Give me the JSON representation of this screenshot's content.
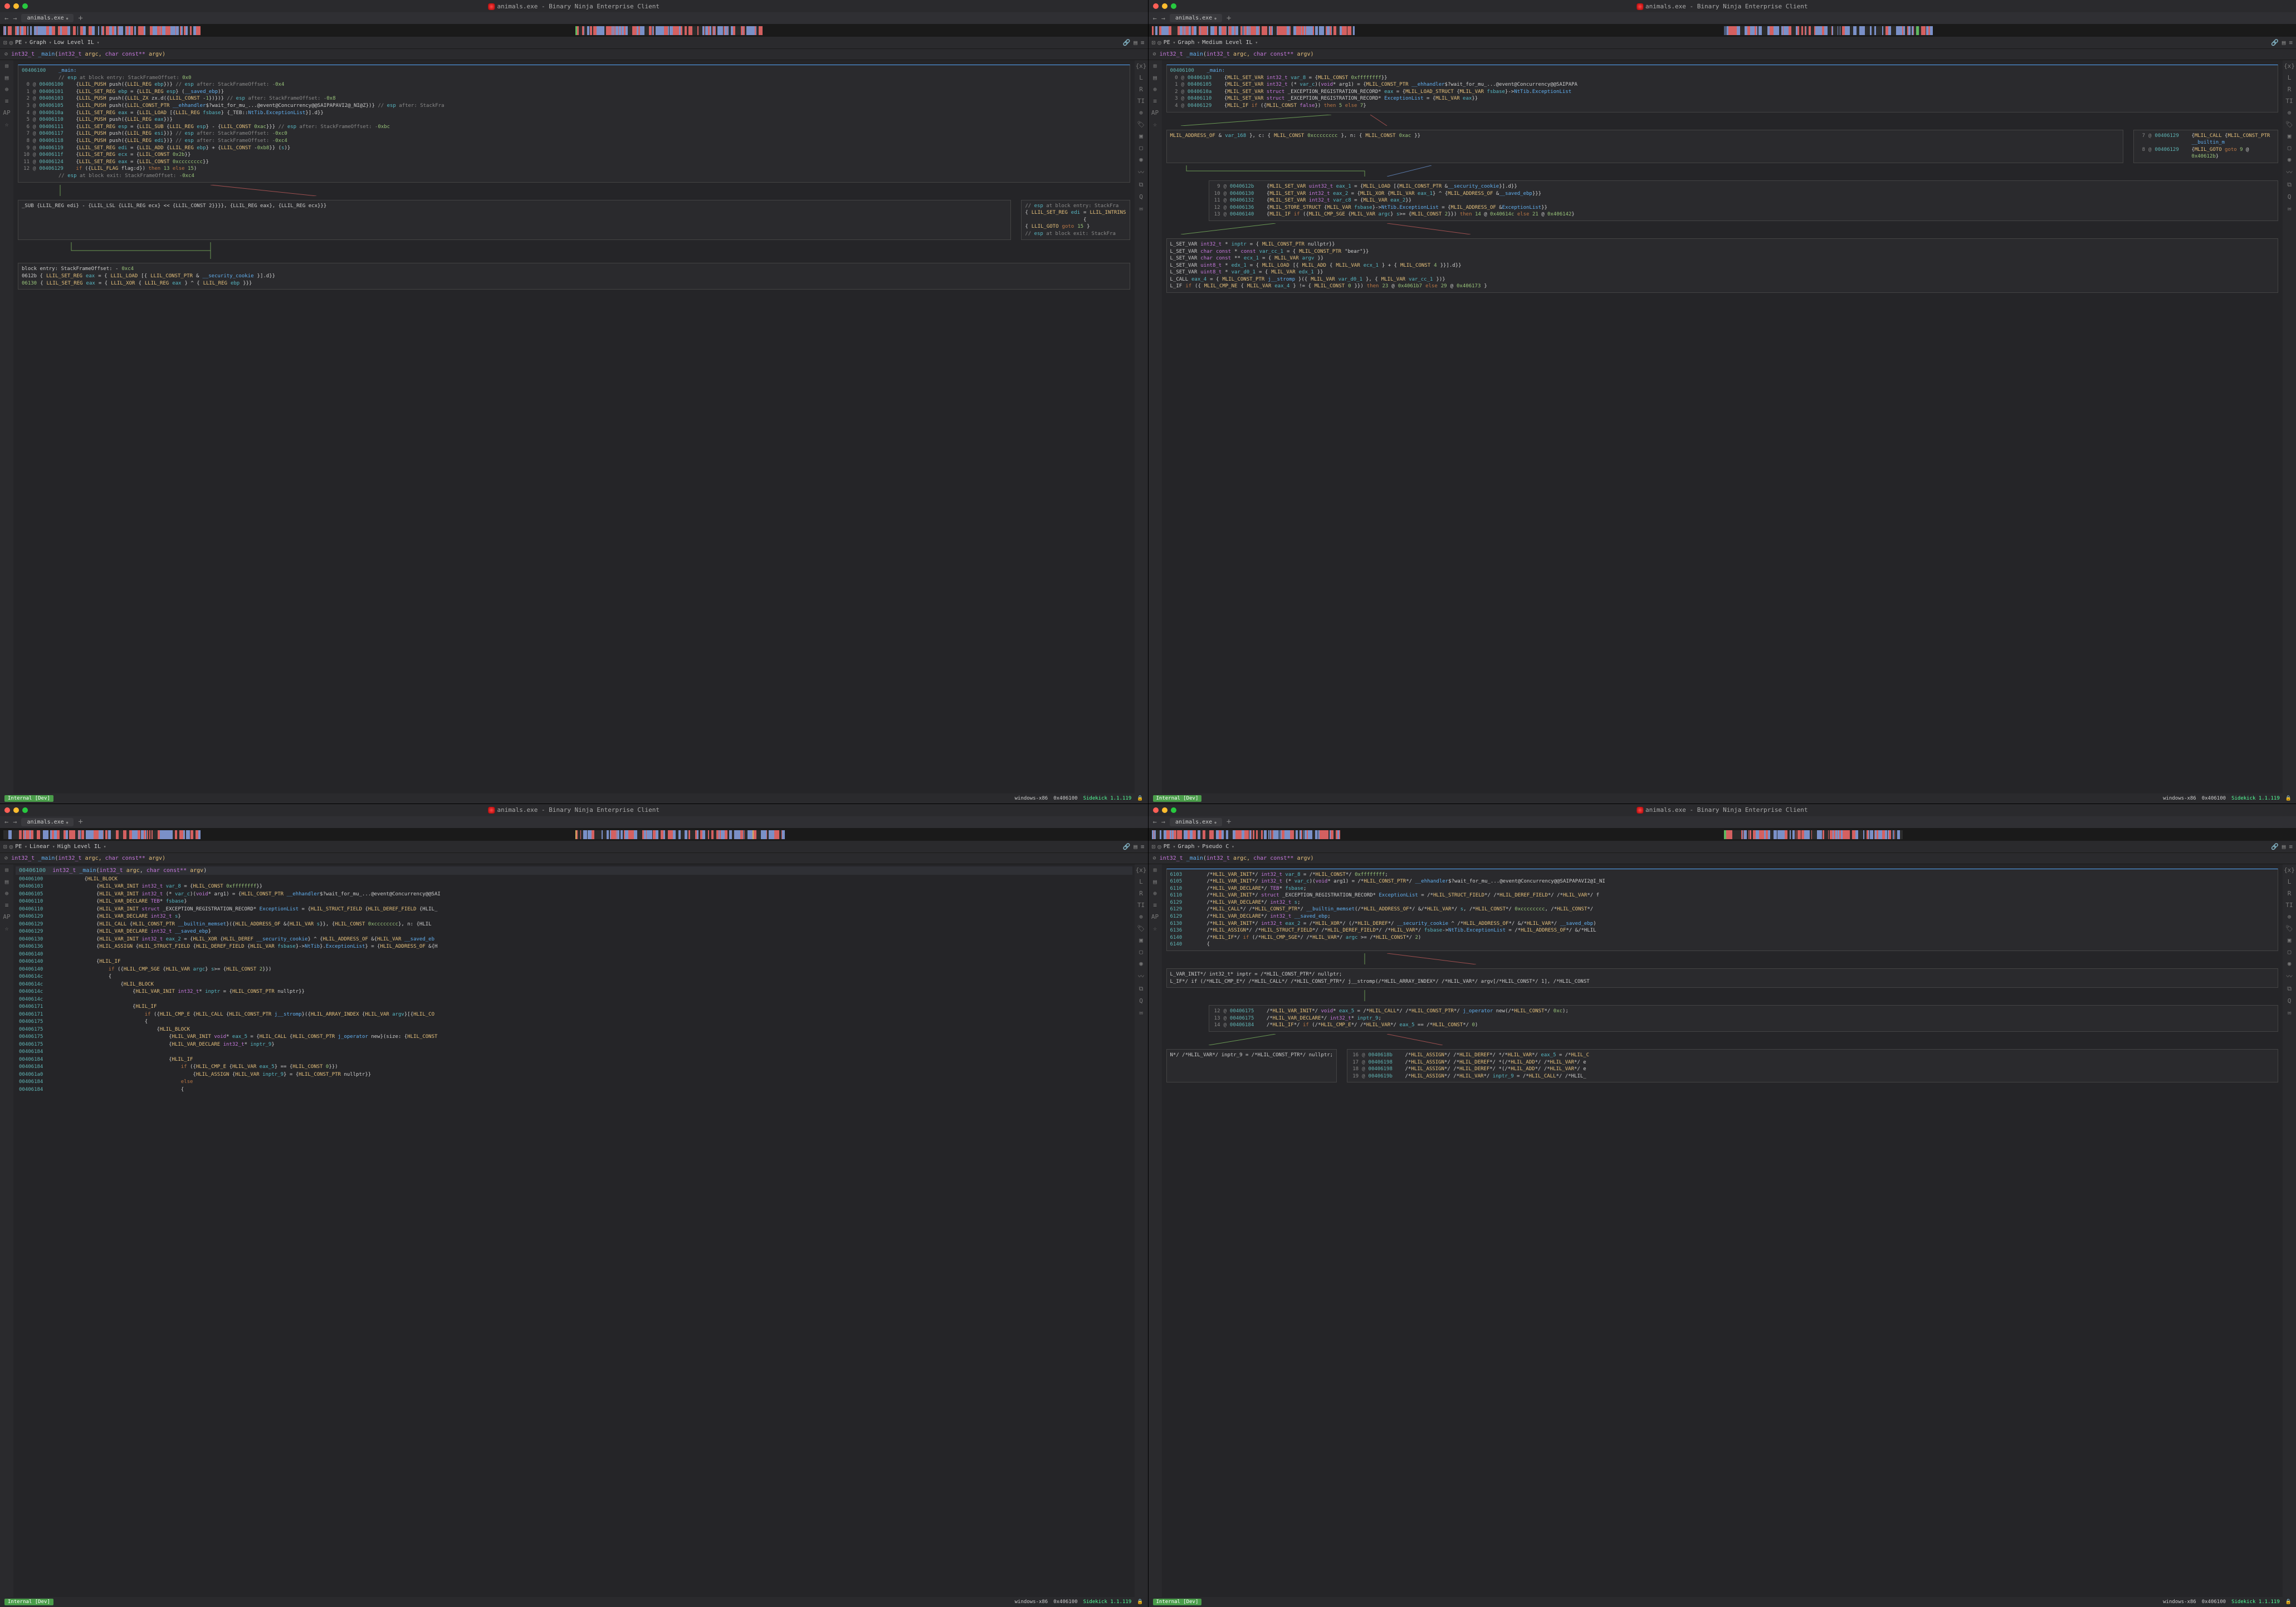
{
  "title_text": "animals.exe - Binary Ninja Enterprise Client",
  "tab_label": "animals.exe",
  "feature": {
    "pe": "PE",
    "graph": "Graph",
    "linear": "Linear",
    "il_low": "Low Level IL",
    "il_med": "Medium Level IL",
    "il_high": "High Level IL",
    "il_pseudo": "Pseudo C"
  },
  "fn_sig": {
    "pre": "int32_t ",
    "name": "_main",
    "args_open": "(",
    "arg1_type": "int32_t ",
    "arg1_name": "argc, ",
    "arg2_type": "char const** ",
    "arg2_name": "argv)",
    "icon": "⊘"
  },
  "fn_hl_sig": "int32_t _main(int32_t argc, char const** argv)",
  "status": {
    "internal": "Internal [Dev]",
    "arch": "windows-x86",
    "addr": "0x406100",
    "sidekick": "Sidekick 1.1.119"
  },
  "pane1": {
    "header_addr": "00406100",
    "header_label": "_main:",
    "lines": [
      {
        "addr": "",
        "text": "// esp at block entry: StackFrameOffset: 0x0",
        "cls": "kw-comment"
      },
      {
        "i": "0",
        "addr": "00406100",
        "text": "{LLIL_PUSH push({LLIL_REG ebp})}  // esp after: StackFrameOffset: -0x4"
      },
      {
        "i": "1",
        "addr": "00406101",
        "text": "{LLIL_SET_REG ebp = {LLIL_REG esp} (__saved_ebp)}"
      },
      {
        "i": "2",
        "addr": "00406103",
        "text": "{LLIL_PUSH push({LLIL_ZX zx.d({LLIL_CONST -1})})}  // esp after: StackFrameOffset: -0x8"
      },
      {
        "i": "3",
        "addr": "00406105",
        "text": "{LLIL_PUSH push({LLIL_CONST_PTR __ehhandler$?wait_for_mu_...@event@Concurrency@@SAIPAPAVI2@_NI@Z})}  // esp after: StackFra"
      },
      {
        "i": "4",
        "addr": "0040610a",
        "text": "{LLIL_SET_REG eax = {LLIL_LOAD [{LLIL_REG fsbase} {_TEB::NtTib.ExceptionList}].d}}"
      },
      {
        "i": "5",
        "addr": "00406110",
        "text": "{LLIL_PUSH push({LLIL_REG eax})}"
      },
      {
        "i": "6",
        "addr": "00406111",
        "text": "{LLIL_SET_REG esp = {LLIL_SUB {LLIL_REG esp} - {LLIL_CONST 0xac}}}  // esp after: StackFrameOffset: -0xbc"
      },
      {
        "i": "7",
        "addr": "00406117",
        "text": "{LLIL_PUSH push({LLIL_REG esi})}  // esp after: StackFrameOffset: -0xc0"
      },
      {
        "i": "8",
        "addr": "00406118",
        "text": "{LLIL_PUSH push({LLIL_REG edi})}  // esp after: StackFrameOffset: -0xc4"
      },
      {
        "i": "9",
        "addr": "00406119",
        "text": "{LLIL_SET_REG edi = {LLIL_ADD {LLIL_REG ebp} + {LLIL_CONST -0xb8}} (s)}"
      },
      {
        "i": "10",
        "addr": "0040611f",
        "text": "{LLIL_SET_REG ecx = {LLIL_CONST 0x2b}}"
      },
      {
        "i": "11",
        "addr": "00406124",
        "text": "{LLIL_SET_REG eax = {LLIL_CONST 0xcccccccc}}"
      },
      {
        "i": "12",
        "addr": "00406129",
        "text": "if ({LLIL_FLAG flag:d}) then 13 else 15)"
      },
      {
        "addr": "",
        "text": "// esp at block exit: StackFrameOffset: -0xc4",
        "cls": "kw-comment"
      }
    ],
    "subblock": "_SUB {LLIL_REG edi} - {LLIL_LSL {LLIL_REG ecx} << {LLIL_CONST 2}}}}, {LLIL_REG eax}, {LLIL_REG ecx}}}",
    "sideblock": [
      "// esp at block entry: StackFra",
      "{LLIL_SET_REG edi = {LLIL_INTRINS",
      "{LLIL_GOTO goto 15}",
      "// esp at block exit: StackFra"
    ],
    "bottom": [
      "block entry: StackFrameOffset: -0xc4",
      "0612b  {LLIL_SET_REG eax = {LLIL_LOAD [{LLIL_CONST_PTR &__security_cookie}].d}}",
      "06130  {LLIL_SET_REG eax = {LLIL_XOR {LLIL_REG eax} ^ {LLIL_REG ebp}}}"
    ]
  },
  "pane2": {
    "header_addr": "00406100",
    "header_label": "_main:",
    "lines": [
      {
        "i": "0",
        "addr": "00406103",
        "text": "{MLIL_SET_VAR int32_t var_8 = {MLIL_CONST 0xffffffff}}"
      },
      {
        "i": "1",
        "addr": "00406105",
        "text": "{MLIL_SET_VAR int32_t (* var_c)(void* arg1) = {MLIL_CONST_PTR __ehhandler$?wait_for_mu_...@event@Concurrency@@SAIPAPA"
      },
      {
        "i": "2",
        "addr": "0040610a",
        "text": "{MLIL_SET_VAR struct _EXCEPTION_REGISTRATION_RECORD* eax = {MLIL_LOAD_STRUCT {MLIL_VAR fsbase}->NtTib.ExceptionList"
      },
      {
        "i": "3",
        "addr": "00406110",
        "text": "{MLIL_SET_VAR struct _EXCEPTION_REGISTRATION_RECORD* ExceptionList = {MLIL_VAR eax}}"
      },
      {
        "i": "4",
        "addr": "00406129",
        "text": "{MLIL_IF if ({MLIL_CONST false}) then 5 else 7}"
      }
    ],
    "line57": [
      {
        "text": "MLIL_ADDRESS_OF &var_168}, c: {MLIL_CONST 0xcccccccc}, n: {MLIL_CONST 0xac}}"
      }
    ],
    "block57b": [
      {
        "i": "7",
        "addr": "00406129",
        "text": "{MLIL_CALL {MLIL_CONST_PTR __builtin_m"
      },
      {
        "i": "8",
        "addr": "00406129",
        "text": "{MLIL_GOTO goto 9 @ 0x40612b}"
      }
    ],
    "block9": [
      {
        "i": "9",
        "addr": "0040612b",
        "text": "{MLIL_SET_VAR uint32_t eax_1 = {MLIL_LOAD [{MLIL_CONST_PTR &__security_cookie}].d}}"
      },
      {
        "i": "10",
        "addr": "00406130",
        "text": "{MLIL_SET_VAR int32_t eax_2 = {MLIL_XOR {MLIL_VAR eax_1} ^ {MLIL_ADDRESS_OF &__saved_ebp}}}"
      },
      {
        "i": "11",
        "addr": "00406132",
        "text": "{MLIL_SET_VAR int32_t var_c8 = {MLIL_VAR eax_2}}"
      },
      {
        "i": "12",
        "addr": "00406136",
        "text": "{MLIL_STORE_STRUCT {MLIL_VAR fsbase}->NtTib.ExceptionList = {MLIL_ADDRESS_OF &ExceptionList}}"
      },
      {
        "i": "13",
        "addr": "00406140",
        "text": "{MLIL_IF if ({MLIL_CMP_SGE {MLIL_VAR argc} s>= {MLIL_CONST 2}}) then 14 @ 0x40614c else 21 @ 0x406142}"
      }
    ],
    "bottom": [
      "L_SET_VAR int32_t* inptr = {MLIL_CONST_PTR nullptr}}",
      "L_SET_VAR char const* const var_cc_1 = {MLIL_CONST_PTR \"bear\"}}",
      "L_SET_VAR char const** ecx_1 = {MLIL_VAR argv}}",
      "L_SET_VAR uint8_t* edx_1 = {MLIL_LOAD [{MLIL_ADD {MLIL_VAR ecx_1} + {MLIL_CONST 4}}].d}}",
      "L_SET_VAR uint8_t* var_d0_1 = {MLIL_VAR edx_1}}",
      "L_CALL eax_4 = {MLIL_CONST_PTR j__stromp}({MLIL_VAR var_d0_1}, {MLIL_VAR var_cc_1})}",
      "L_IF if ({MLIL_CMP_NE {MLIL_VAR eax_4} != {MLIL_CONST 0}}) then 23 @ 0x4061b7 else 29 @ 0x406173}"
    ]
  },
  "pane3": {
    "header_addr": "00406100",
    "hl_sig_addr": "00406100",
    "lines": [
      {
        "addr": "00406100",
        "ind": 2,
        "text": "{HLIL_BLOCK"
      },
      {
        "addr": "00406103",
        "ind": 3,
        "text": "{HLIL_VAR_INIT int32_t var_8 = {HLIL_CONST 0xffffffff}}"
      },
      {
        "addr": "00406105",
        "ind": 3,
        "text": "{HLIL_VAR_INIT int32_t (* var_c)(void* arg1) = {HLIL_CONST_PTR __ehhandler$?wait_for_mu_...@event@Concurrency@@SAI"
      },
      {
        "addr": "00406110",
        "ind": 3,
        "text": "{HLIL_VAR_DECLARE TEB* fsbase}"
      },
      {
        "addr": "00406110",
        "ind": 3,
        "text": "{HLIL_VAR_INIT struct _EXCEPTION_REGISTRATION_RECORD* ExceptionList = {HLIL_STRUCT_FIELD {HLIL_DEREF_FIELD {HLIL_"
      },
      {
        "addr": "00406129",
        "ind": 3,
        "text": "{HLIL_VAR_DECLARE int32_t s}"
      },
      {
        "addr": "00406129",
        "ind": 3,
        "text": "{HLIL_CALL {HLIL_CONST_PTR __builtin_memset}({HLIL_ADDRESS_OF &{HLIL_VAR s}}, {HLIL_CONST 0xcccccccc}, n: {HLIL"
      },
      {
        "addr": "00406129",
        "ind": 3,
        "text": "{HLIL_VAR_DECLARE int32_t __saved_ebp}"
      },
      {
        "addr": "00406130",
        "ind": 3,
        "text": "{HLIL_VAR_INIT int32_t eax_2 = {HLIL_XOR {HLIL_DEREF __security_cookie} ^ {HLIL_ADDRESS_OF &{HLIL_VAR __saved_eb"
      },
      {
        "addr": "00406136",
        "ind": 3,
        "text": "{HLIL_ASSIGN {HLIL_STRUCT_FIELD {HLIL_DEREF_FIELD {HLIL_VAR fsbase}->NtTib}.ExceptionList} = {HLIL_ADDRESS_OF &{H"
      },
      {
        "addr": "00406140",
        "ind": 3,
        "text": ""
      },
      {
        "addr": "00406140",
        "ind": 3,
        "text": "{HLIL_IF"
      },
      {
        "addr": "00406140",
        "ind": 4,
        "text": "if ({HLIL_CMP_SGE {HLIL_VAR argc} s>= {HLIL_CONST 2}})"
      },
      {
        "addr": "0040614c",
        "ind": 4,
        "text": "{"
      },
      {
        "addr": "0040614c",
        "ind": 5,
        "text": "{HLIL_BLOCK"
      },
      {
        "addr": "0040614c",
        "ind": 6,
        "text": "{HLIL_VAR_INIT int32_t* inptr = {HLIL_CONST_PTR nullptr}}"
      },
      {
        "addr": "0040614c",
        "ind": 6,
        "text": ""
      },
      {
        "addr": "00406171",
        "ind": 6,
        "text": "{HLIL_IF"
      },
      {
        "addr": "00406171",
        "ind": 7,
        "text": "if ({HLIL_CMP_E {HLIL_CALL {HLIL_CONST_PTR j__stromp}({HLIL_ARRAY_INDEX {HLIL_VAR argv}[{HLIL_CO"
      },
      {
        "addr": "00406175",
        "ind": 7,
        "text": "{"
      },
      {
        "addr": "00406175",
        "ind": 8,
        "text": "{HLIL_BLOCK"
      },
      {
        "addr": "00406175",
        "ind": 9,
        "text": "{HLIL_VAR_INIT void* eax_5 = {HLIL_CALL {HLIL_CONST_PTR j_operator new}(size: {HLIL_CONST"
      },
      {
        "addr": "00406175",
        "ind": 9,
        "text": "{HLIL_VAR_DECLARE int32_t* inptr_9}"
      },
      {
        "addr": "00406184",
        "ind": 9,
        "text": ""
      },
      {
        "addr": "00406184",
        "ind": 9,
        "text": "{HLIL_IF"
      },
      {
        "addr": "00406184",
        "ind": 10,
        "text": "if ({HLIL_CMP_E {HLIL_VAR eax_5} == {HLIL_CONST 0}})"
      },
      {
        "addr": "004061a0",
        "ind": 11,
        "text": "{HLIL_ASSIGN {HLIL_VAR inptr_9} = {HLIL_CONST_PTR nullptr}}"
      },
      {
        "addr": "00406184",
        "ind": 10,
        "text": "else"
      },
      {
        "addr": "00406184",
        "ind": 10,
        "text": "{"
      }
    ]
  },
  "pane4": {
    "lines": [
      {
        "addr": "6103",
        "text": "/*HLIL_VAR_INIT*/ int32_t var_8 = /*HLIL_CONST*/ 0xffffffff;"
      },
      {
        "addr": "6105",
        "text": "/*HLIL_VAR_INIT*/ int32_t (* var_c)(void* arg1) = /*HLIL_CONST_PTR*/ __ehhandler$?wait_for_mu_...@event@Concurrency@@SAIPAPAVI2@I_NI"
      },
      {
        "addr": "6110",
        "text": "/*HLIL_VAR_DECLARE*/ TEB* fsbase;"
      },
      {
        "addr": "6110",
        "text": "/*HLIL_VAR_INIT*/ struct _EXCEPTION_REGISTRATION_RECORD* ExceptionList = /*HLIL_STRUCT_FIELD*/ /*HLIL_DEREF_FIELD*/ /*HLIL_VAR*/ f"
      },
      {
        "addr": "6129",
        "text": "/*HLIL_VAR_DECLARE*/ int32_t s;"
      },
      {
        "addr": "6129",
        "text": "/*HLIL_CALL*/ /*HLIL_CONST_PTR*/ __builtin_memset(/*HLIL_ADDRESS_OF*/ &/*HLIL_VAR*/ s, /*HLIL_CONST*/ 0xcccccccc, /*HLIL_CONST*/"
      },
      {
        "addr": "6129",
        "text": "/*HLIL_VAR_DECLARE*/ int32_t __saved_ebp;"
      },
      {
        "addr": "6130",
        "text": "/*HLIL_VAR_INIT*/ int32_t eax_2 = /*HLIL_XOR*/ (/*HLIL_DEREF*/ __security_cookie ^ /*HLIL_ADDRESS_OF*/ &/*HLIL_VAR*/ __saved_ebp)"
      },
      {
        "addr": "6136",
        "text": "/*HLIL_ASSIGN*/ /*HLIL_STRUCT_FIELD*/ /*HLIL_DEREF_FIELD*/ /*HLIL_VAR*/ fsbase->NtTib.ExceptionList = /*HLIL_ADDRESS_OF*/ &/*HLIL"
      },
      {
        "addr": "6140",
        "text": "/*HLIL_IF*/ if (/*HLIL_CMP_SGE*/ /*HLIL_VAR*/ argc >= /*HLIL_CONST*/ 2)"
      },
      {
        "addr": "6140",
        "text": "{"
      }
    ],
    "splitL": "L_VAR_INIT*/ int32_t* inptr = /*HLIL_CONST_PTR*/ nullptr;",
    "splitL2": "L_IF*/ if (/*HLIL_CMP_E*/ /*HLIL_CALL*/ /*HLIL_CONST_PTR*/ j__stromp(/*HLIL_ARRAY_INDEX*/ /*HLIL_VAR*/ argv[/*HLIL_CONST*/ 1], /*HLIL_CONST",
    "block12": [
      {
        "i": "12",
        "addr": "00406175",
        "text": "/*HLIL_VAR_INIT*/ void* eax_5 = /*HLIL_CALL*/ /*HLIL_CONST_PTR*/ j_operator new(/*HLIL_CONST*/ 0xc);"
      },
      {
        "i": "13",
        "addr": "00406175",
        "text": "/*HLIL_VAR_DECLARE*/ int32_t* inptr_9;"
      },
      {
        "i": "14",
        "addr": "00406184",
        "text": "/*HLIL_IF*/ if (/*HLIL_CMP_E*/ /*HLIL_VAR*/ eax_5 == /*HLIL_CONST*/ 0)"
      }
    ],
    "split_null": "N*/ /*HLIL_VAR*/ inptr_9 = /*HLIL_CONST_PTR*/ nullptr;",
    "block16": [
      {
        "i": "16",
        "addr": "0040618b",
        "text": "/*HLIL_ASSIGN*/ /*HLIL_DEREF*/ */*HLIL_VAR*/ eax_5 = /*HLIL_C"
      },
      {
        "i": "17",
        "addr": "00406198",
        "text": "/*HLIL_ASSIGN*/ /*HLIL_DEREF*/ *(/*HLIL_ADD*/ /*HLIL_VAR*/ e"
      },
      {
        "i": "18",
        "addr": "00406198",
        "text": "/*HLIL_ASSIGN*/ /*HLIL_DEREF*/ *(/*HLIL_ADD*/ /*HLIL_VAR*/ e"
      },
      {
        "i": "19",
        "addr": "0040619b",
        "text": "/*HLIL_ASSIGN*/ /*HLIL_VAR*/ inptr_9 = /*HLIL_CALL*/ /*HLIL_"
      }
    ]
  },
  "sidebar_left": [
    "⊞",
    "▤",
    "⊕",
    "≡",
    "AP",
    "☆"
  ],
  "sidebar_right": [
    "{x}",
    "L",
    "R",
    "TI",
    "⊕",
    "🏷",
    "▣",
    "▢",
    "◉",
    "〰",
    "⧉",
    "Q",
    "✉"
  ]
}
